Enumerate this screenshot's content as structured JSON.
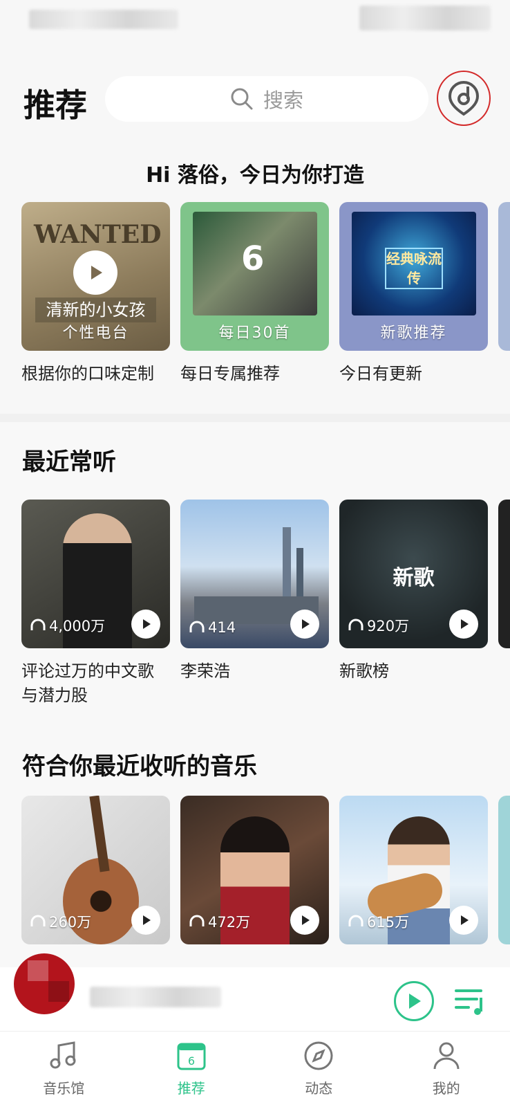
{
  "header": {
    "title": "推荐",
    "search_placeholder": "搜索"
  },
  "greeting": "Hi 落俗，今日为你打造",
  "daily": [
    {
      "overlay_label": "个性电台",
      "caption": "根据你的口味定制",
      "cover_text": "WANTED",
      "cover_sub": "清新的小女孩"
    },
    {
      "overlay_label": "每日30首",
      "caption": "每日专属推荐",
      "cover_number": "6"
    },
    {
      "overlay_label": "新歌推荐",
      "caption": "今日有更新",
      "cover_text": "经典咏流传"
    }
  ],
  "recent": {
    "title": "最近常听",
    "items": [
      {
        "count": "4,000万",
        "caption": "评论过万的中文歌与潜力股"
      },
      {
        "count": "414",
        "caption": "李荣浩"
      },
      {
        "count": "920万",
        "caption": "新歌榜",
        "cover_text": "新歌"
      }
    ]
  },
  "suggested": {
    "title": "符合你最近收听的音乐",
    "items": [
      {
        "count": "260万"
      },
      {
        "count": "472万"
      },
      {
        "count": "615万"
      }
    ]
  },
  "tabs": [
    {
      "label": "音乐馆"
    },
    {
      "label": "推荐",
      "badge": "6"
    },
    {
      "label": "动态"
    },
    {
      "label": "我的"
    }
  ],
  "colors": {
    "accent": "#2dc38a",
    "highlight_ring": "#d32a2a"
  }
}
